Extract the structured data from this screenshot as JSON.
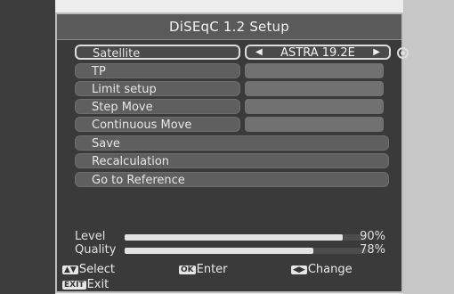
{
  "window": {
    "title": "DiSEqC 1.2 Setup"
  },
  "menu": {
    "satellite": {
      "label": "Satellite",
      "value": "ASTRA 19.2E"
    },
    "tp": {
      "label": "TP"
    },
    "limit_setup": {
      "label": "Limit setup"
    },
    "step_move": {
      "label": "Step Move"
    },
    "continuous_move": {
      "label": "Continuous Move"
    },
    "save": {
      "label": "Save"
    },
    "recalculation": {
      "label": "Recalculation"
    },
    "go_to_reference": {
      "label": "Go to Reference"
    }
  },
  "meters": {
    "level": {
      "label": "Level",
      "percent_text": "90%",
      "value": 0.9
    },
    "quality": {
      "label": "Quality",
      "percent_text": "78%",
      "value": 0.78
    }
  },
  "footer": {
    "select": {
      "key": "▲▼",
      "label": "Select"
    },
    "enter": {
      "key": "OK",
      "label": "Enter"
    },
    "change": {
      "key": "◀▶",
      "label": "Change"
    },
    "exit": {
      "key": "EXIT",
      "label": "Exit"
    }
  }
}
